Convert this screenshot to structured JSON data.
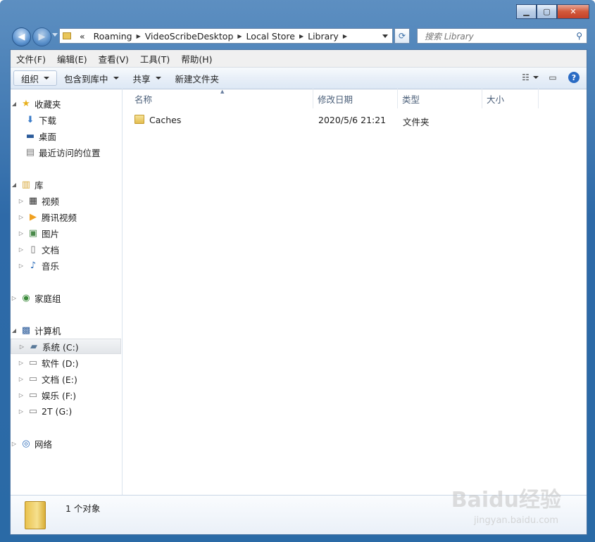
{
  "window": {
    "min_symbol": "▁",
    "max_symbol": "▢",
    "close_symbol": "✕"
  },
  "nav": {
    "address_parts": [
      "«",
      "Roaming",
      "VideoScribeDesktop",
      "Local Store",
      "Library"
    ],
    "search_placeholder": "搜索 Library"
  },
  "menu": [
    "文件(F)",
    "编辑(E)",
    "查看(V)",
    "工具(T)",
    "帮助(H)"
  ],
  "toolbar": {
    "organize": "组织",
    "include": "包含到库中",
    "share": "共享",
    "new_folder": "新建文件夹"
  },
  "sidebar": {
    "favorites": "收藏夹",
    "fav_items": [
      "下载",
      "桌面",
      "最近访问的位置"
    ],
    "libraries": "库",
    "lib_items": [
      "视频",
      "腾讯视频",
      "图片",
      "文档",
      "音乐"
    ],
    "homegroup": "家庭组",
    "computer": "计算机",
    "drives": [
      "系统 (C:)",
      "软件 (D:)",
      "文档 (E:)",
      "娱乐 (F:)",
      "2T (G:)"
    ],
    "network": "网络"
  },
  "columns": [
    "名称",
    "修改日期",
    "类型",
    "大小"
  ],
  "files": [
    {
      "name": "Caches",
      "date": "2020/5/6 21:21",
      "type": "文件夹",
      "size": ""
    }
  ],
  "details": {
    "count_text": "1 个对象"
  },
  "watermark": {
    "main": "Baidu经验",
    "url": "jingyan.baidu.com"
  }
}
